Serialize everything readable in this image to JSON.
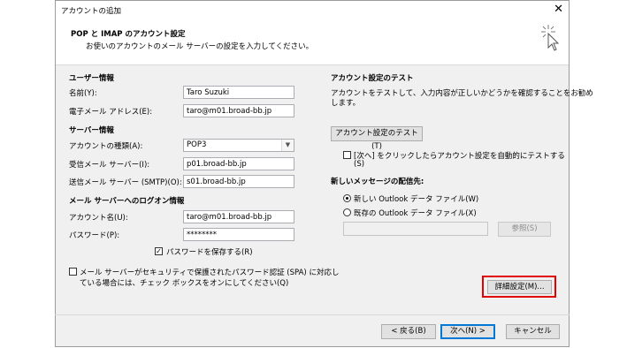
{
  "window": {
    "title": "アカウントの追加",
    "close": "✕"
  },
  "header": {
    "title": "POP と IMAP のアカウント設定",
    "description": "お使いのアカウントのメール サーバーの設定を入力してください。"
  },
  "user_info": {
    "heading": "ユーザー情報",
    "name_label": "名前(Y):",
    "name_value": "Taro Suzuki",
    "email_label": "電子メール アドレス(E):",
    "email_value": "taro@m01.broad-bb.jp"
  },
  "server_info": {
    "heading": "サーバー情報",
    "account_type_label": "アカウントの種類(A):",
    "account_type_value": "POP3",
    "incoming_label": "受信メール サーバー(I):",
    "incoming_value": "p01.broad-bb.jp",
    "outgoing_label": "送信メール サーバー (SMTP)(O):",
    "outgoing_value": "s01.broad-bb.jp"
  },
  "logon_info": {
    "heading": "メール サーバーへのログオン情報",
    "account_name_label": "アカウント名(U):",
    "account_name_value": "taro@m01.broad-bb.jp",
    "password_label": "パスワード(P):",
    "password_value": "********",
    "remember_password_label": "パスワードを保存する(R)",
    "remember_password_checked": true,
    "spa_line1": "メール サーバーがセキュリティで保護されたパスワード認証 (SPA) に対応し",
    "spa_line2": "ている場合には、チェック ボックスをオンにしてください(Q)",
    "spa_checked": false
  },
  "test": {
    "heading": "アカウント設定のテスト",
    "desc_line1": "アカウントをテストして、入力内容が正しいかどうかを確認することをお勧め",
    "desc_line2": "します。",
    "test_button": "アカウント設定のテスト(T)",
    "auto_test_line1": "[次へ] をクリックしたらアカウント設定を自動的にテストする",
    "auto_test_line2": "(S)",
    "auto_test_checked": false
  },
  "delivery": {
    "heading": "新しいメッセージの配信先:",
    "option_new": "新しい Outlook データ ファイル(W)",
    "option_existing": "既存の Outlook データ ファイル(X)",
    "selected": "new",
    "path_value": "",
    "browse_button": "参照(S)"
  },
  "buttons": {
    "more_settings": "詳細設定(M)...",
    "back": "< 戻る(B)",
    "next": "次へ(N) >",
    "cancel": "キャンセル"
  },
  "colors": {
    "highlight": "#e30000",
    "dialog_bg": "#f0f0f0",
    "default_button_border": "#0078d7"
  }
}
